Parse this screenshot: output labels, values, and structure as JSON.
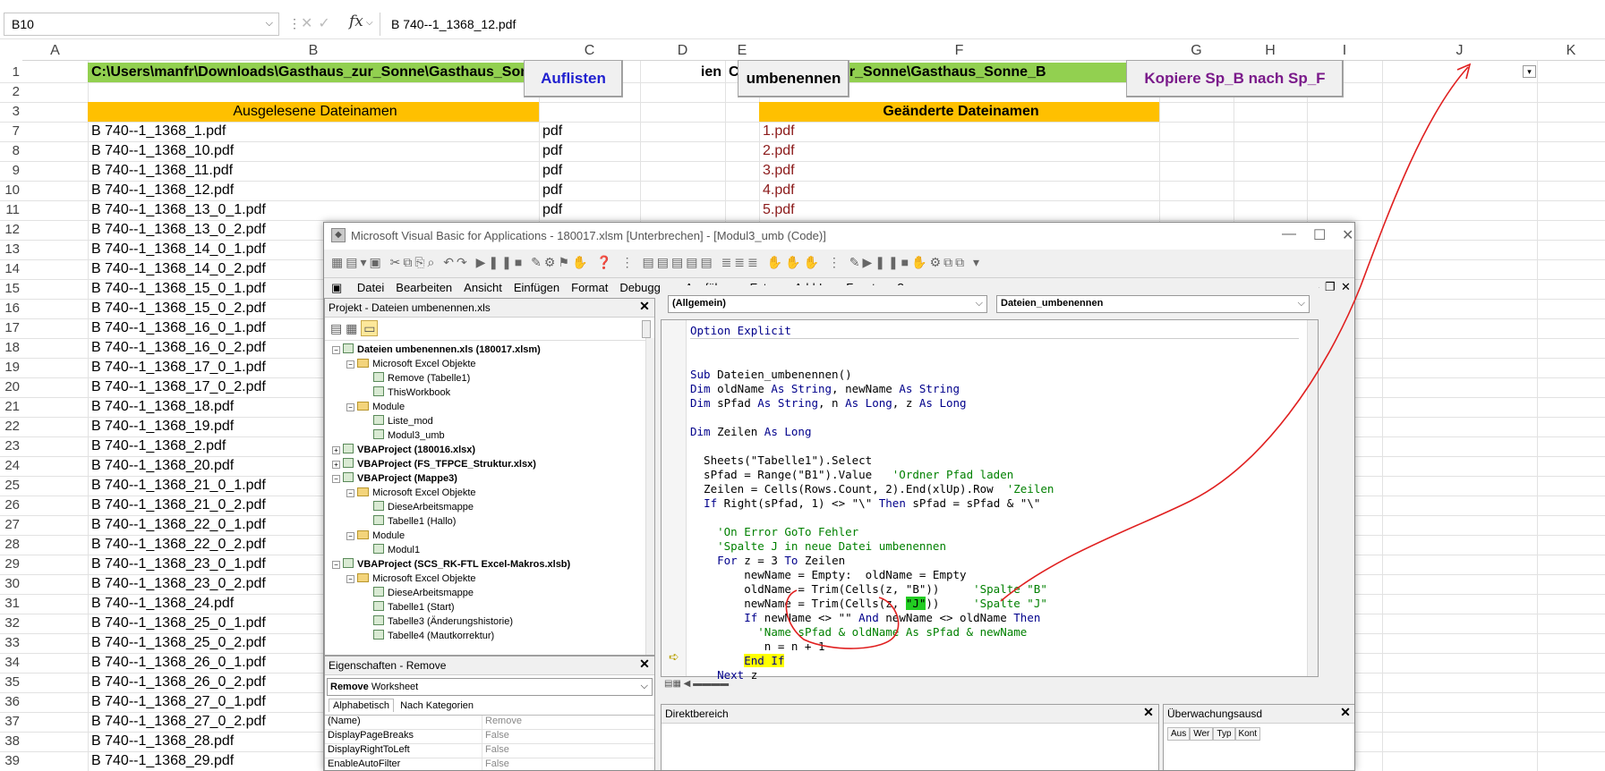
{
  "formula_bar": {
    "name_box": "B10",
    "fx": "fx",
    "content": "B 740--1_1368_12.pdf"
  },
  "columns": [
    "A",
    "B",
    "C",
    "D",
    "E",
    "F",
    "G",
    "H",
    "I",
    "J",
    "K"
  ],
  "row_numbers": [
    "1",
    "2",
    "3",
    "7",
    "8",
    "9",
    "10",
    "11",
    "12",
    "13",
    "14",
    "15",
    "16",
    "17",
    "18",
    "19",
    "20",
    "21",
    "22",
    "23",
    "24",
    "25",
    "26",
    "27",
    "28",
    "29",
    "30",
    "31",
    "32",
    "33",
    "34",
    "35",
    "36",
    "37",
    "38",
    "39"
  ],
  "row1": {
    "b1": "C:\\Users\\manfr\\Downloads\\Gasthaus_zur_Sonne\\Gasthaus_Sonne_Bilder",
    "d1_tail": "ien",
    "e1": "C:\\Users\\ma",
    "f1": "gasthaus_zur_Sonne\\Gasthaus_Sonne_B"
  },
  "buttons": {
    "auflisten": "Auflisten",
    "umbenennen": "umbenennen",
    "kopiere": "Kopiere Sp_B nach Sp_F"
  },
  "headers": {
    "b3": "Ausgelesene Dateinamen",
    "f3": "Geänderte Dateinamen"
  },
  "colors": {
    "green": "#92d050",
    "orange": "#ffc000",
    "annotation_red": "#e02020",
    "highlight_green": "#22cc22"
  },
  "file_names": [
    "B 740--1_1368_1.pdf",
    "B 740--1_1368_10.pdf",
    "B 740--1_1368_11.pdf",
    "B 740--1_1368_12.pdf",
    "B 740--1_1368_13_0_1.pdf",
    "B 740--1_1368_13_0_2.pdf",
    "B 740--1_1368_14_0_1.pdf",
    "B 740--1_1368_14_0_2.pdf",
    "B 740--1_1368_15_0_1.pdf",
    "B 740--1_1368_15_0_2.pdf",
    "B 740--1_1368_16_0_1.pdf",
    "B 740--1_1368_16_0_2.pdf",
    "B 740--1_1368_17_0_1.pdf",
    "B 740--1_1368_17_0_2.pdf",
    "B 740--1_1368_18.pdf",
    "B 740--1_1368_19.pdf",
    "B 740--1_1368_2.pdf",
    "B 740--1_1368_20.pdf",
    "B 740--1_1368_21_0_1.pdf",
    "B 740--1_1368_21_0_2.pdf",
    "B 740--1_1368_22_0_1.pdf",
    "B 740--1_1368_22_0_2.pdf",
    "B 740--1_1368_23_0_1.pdf",
    "B 740--1_1368_23_0_2.pdf",
    "B 740--1_1368_24.pdf",
    "B 740--1_1368_25_0_1.pdf",
    "B 740--1_1368_25_0_2.pdf",
    "B 740--1_1368_26_0_1.pdf",
    "B 740--1_1368_26_0_2.pdf",
    "B 740--1_1368_27_0_1.pdf",
    "B 740--1_1368_27_0_2.pdf",
    "B 740--1_1368_28.pdf",
    "B 740--1_1368_29.pdf"
  ],
  "ext_values": [
    "pdf",
    "pdf",
    "pdf",
    "pdf",
    "pdf"
  ],
  "new_names": [
    "1.pdf",
    "2.pdf",
    "3.pdf",
    "4.pdf",
    "5.pdf"
  ],
  "vba": {
    "title": "Microsoft Visual Basic for Applications - 180017.xlsm [Unterbrechen] - [Modul3_umb (Code)]",
    "menu": [
      "Datei",
      "Bearbeiten",
      "Ansicht",
      "Einfügen",
      "Format",
      "Debuggen",
      "Ausführen",
      "Extras",
      "Add-Ins",
      "Fenster",
      "?"
    ],
    "project_title": "Projekt - Dateien umbenennen.xls",
    "tree": [
      {
        "t": "Dateien umbenennen.xls (180017.xlsm)",
        "l": 0,
        "k": "proj",
        "tg": "−"
      },
      {
        "t": "Microsoft Excel Objekte",
        "l": 1,
        "k": "folder",
        "tg": "−"
      },
      {
        "t": "Remove (Tabelle1)",
        "l": 2,
        "k": "sheet"
      },
      {
        "t": "ThisWorkbook",
        "l": 2,
        "k": "wb"
      },
      {
        "t": "Module",
        "l": 1,
        "k": "folder",
        "tg": "−"
      },
      {
        "t": "Liste_mod",
        "l": 2,
        "k": "mod"
      },
      {
        "t": "Modul3_umb",
        "l": 2,
        "k": "mod"
      },
      {
        "t": "VBAProject (180016.xlsx)",
        "l": 0,
        "k": "proj",
        "tg": "+"
      },
      {
        "t": "VBAProject (FS_TFPCE_Struktur.xlsx)",
        "l": 0,
        "k": "proj",
        "tg": "+"
      },
      {
        "t": "VBAProject (Mappe3)",
        "l": 0,
        "k": "proj",
        "tg": "−"
      },
      {
        "t": "Microsoft Excel Objekte",
        "l": 1,
        "k": "folder",
        "tg": "−"
      },
      {
        "t": "DieseArbeitsmappe",
        "l": 2,
        "k": "wb"
      },
      {
        "t": "Tabelle1 (Hallo)",
        "l": 2,
        "k": "sheet"
      },
      {
        "t": "Module",
        "l": 1,
        "k": "folder",
        "tg": "−"
      },
      {
        "t": "Modul1",
        "l": 2,
        "k": "mod"
      },
      {
        "t": "VBAProject (SCS_RK-FTL Excel-Makros.xlsb)",
        "l": 0,
        "k": "proj",
        "tg": "−"
      },
      {
        "t": "Microsoft Excel Objekte",
        "l": 1,
        "k": "folder",
        "tg": "−"
      },
      {
        "t": "DieseArbeitsmappe",
        "l": 2,
        "k": "wb"
      },
      {
        "t": "Tabelle1 (Start)",
        "l": 2,
        "k": "sheet"
      },
      {
        "t": "Tabelle3 (Änderungshistorie)",
        "l": 2,
        "k": "sheet"
      },
      {
        "t": "Tabelle4 (Mautkorrektur)",
        "l": 2,
        "k": "sheet"
      }
    ],
    "props_title": "Eigenschaften - Remove",
    "props_object": "Remove",
    "props_object_type": "Worksheet",
    "props_tabs": [
      "Alphabetisch",
      "Nach Kategorien"
    ],
    "props": [
      {
        "n": "(Name)",
        "v": "Remove"
      },
      {
        "n": "DisplayPageBreaks",
        "v": "False"
      },
      {
        "n": "DisplayRightToLeft",
        "v": "False"
      },
      {
        "n": "EnableAutoFilter",
        "v": "False"
      }
    ],
    "combo_left": "(Allgemein)",
    "combo_right": "Dateien_umbenennen",
    "immediate_title": "Direktbereich",
    "watch_title": "Überwachungsausd",
    "watch_cols": [
      "Aus",
      "Wer",
      "Typ",
      "Kont"
    ]
  }
}
